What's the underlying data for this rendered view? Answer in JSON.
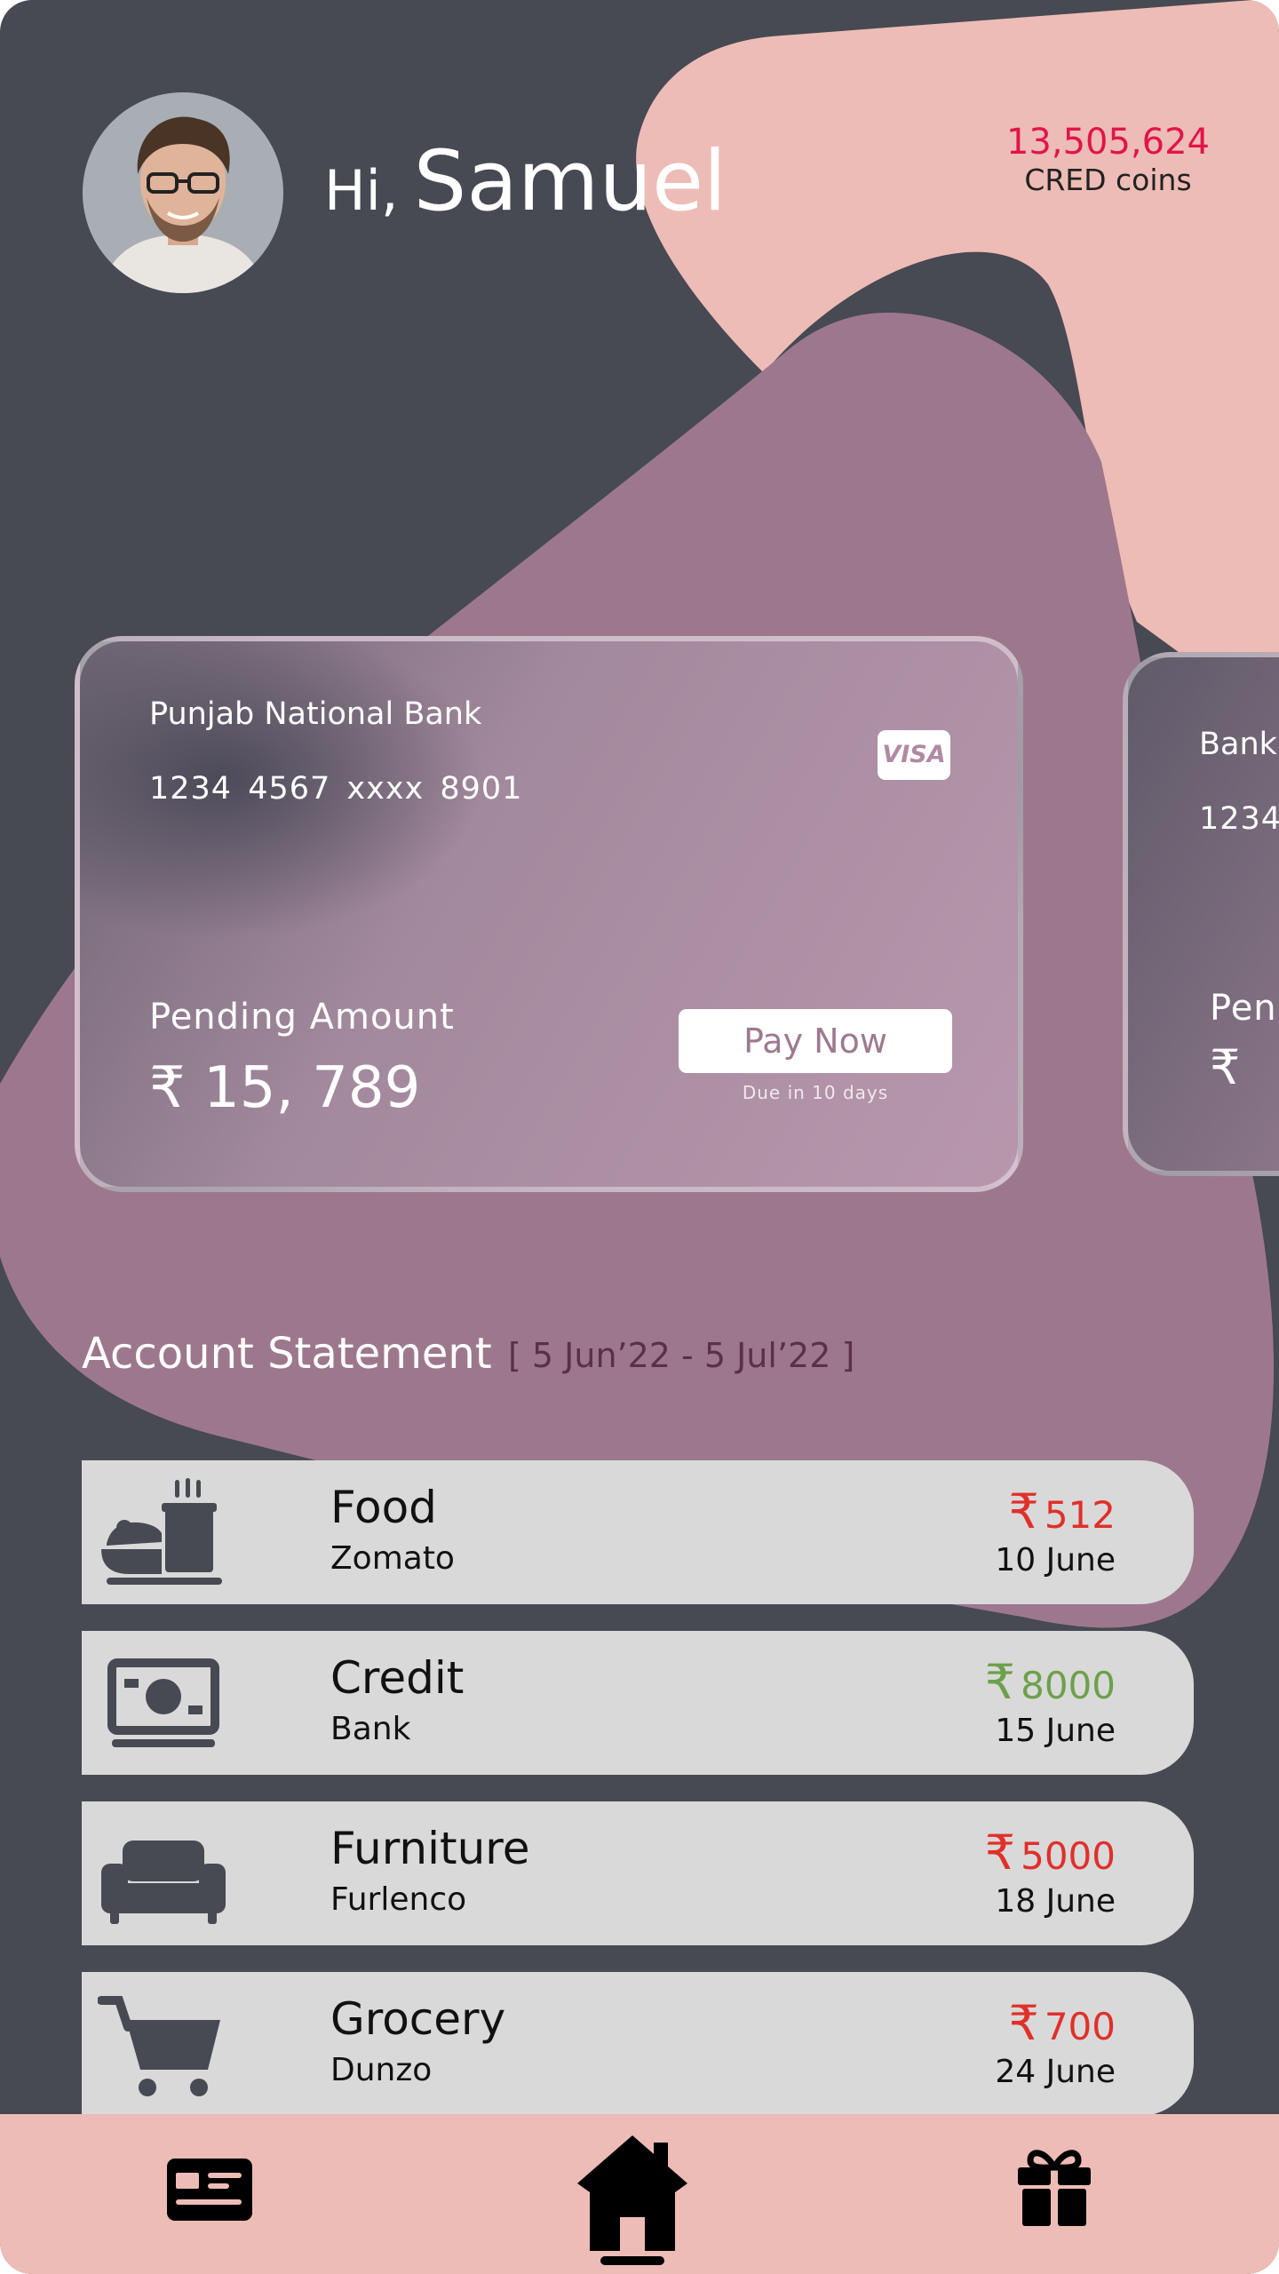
{
  "header": {
    "greeting": "Hi,",
    "user_name": "Samuel",
    "coins_amount": "13,505,624",
    "coins_label": "CRED coins"
  },
  "cards": [
    {
      "bank": "Punjab National Bank",
      "number": "1234  4567  xxxx  8901",
      "network": "VISA",
      "pending_label": "Pending Amount",
      "pending_amount": "₹ 15, 789",
      "pay_button": "Pay Now",
      "due_text": "Due in 10 days"
    },
    {
      "bank": "Bank",
      "number": "1234",
      "pending_label": "Pen",
      "pending_amount": "₹"
    }
  ],
  "statement": {
    "title": "Account Statement",
    "range": "[ 5 Jun’22 - 5 Jul’22 ]"
  },
  "transactions": [
    {
      "icon": "food-icon",
      "title": "Food",
      "subtitle": "Zomato",
      "currency": "₹",
      "amount": "512",
      "date": "10 June",
      "type": "debit"
    },
    {
      "icon": "cash-icon",
      "title": "Credit",
      "subtitle": "Bank",
      "currency": "₹",
      "amount": "8000",
      "date": "15 June",
      "type": "credit"
    },
    {
      "icon": "sofa-icon",
      "title": "Furniture",
      "subtitle": "Furlenco",
      "currency": "₹",
      "amount": "5000",
      "date": "18 June",
      "type": "debit"
    },
    {
      "icon": "cart-icon",
      "title": "Grocery",
      "subtitle": "Dunzo",
      "currency": "₹",
      "amount": "700",
      "date": "24 June",
      "type": "debit"
    }
  ],
  "bottom_nav": {
    "items": [
      "card-icon",
      "home-icon",
      "gift-icon"
    ],
    "active": "home-icon"
  },
  "colors": {
    "background": "#474953",
    "blob_pink": "#eebcb6",
    "blob_mauve": "#9d788c",
    "debit": "#e0302a",
    "credit": "#6da04b",
    "coins": "#e0154a"
  }
}
